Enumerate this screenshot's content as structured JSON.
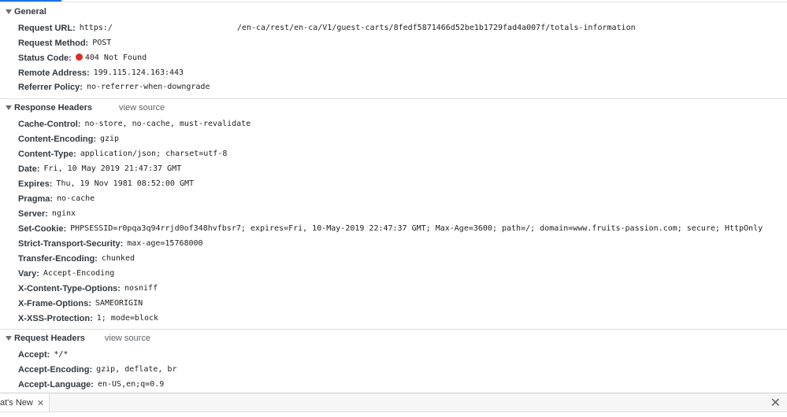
{
  "general": {
    "title": "General",
    "rows": [
      {
        "key": "Request URL:",
        "value_prefix": "https:/",
        "value_suffix": "/en-ca/rest/en-ca/V1/guest-carts/8fedf5871466d52be1b1729fad4a007f/totals-information"
      },
      {
        "key": "Request Method:",
        "value": "POST"
      },
      {
        "key": "Status Code:",
        "value": "404 Not Found",
        "status_color": "#d93025"
      },
      {
        "key": "Remote Address:",
        "value": "199.115.124.163:443"
      },
      {
        "key": "Referrer Policy:",
        "value": "no-referrer-when-downgrade"
      }
    ]
  },
  "response_headers": {
    "title": "Response Headers",
    "view_source": "view source",
    "rows": [
      {
        "key": "Cache-Control:",
        "value": "no-store, no-cache, must-revalidate"
      },
      {
        "key": "Content-Encoding:",
        "value": "gzip"
      },
      {
        "key": "Content-Type:",
        "value": "application/json; charset=utf-8"
      },
      {
        "key": "Date:",
        "value": "Fri, 10 May 2019 21:47:37 GMT"
      },
      {
        "key": "Expires:",
        "value": "Thu, 19 Nov 1981 08:52:00 GMT"
      },
      {
        "key": "Pragma:",
        "value": "no-cache"
      },
      {
        "key": "Server:",
        "value": "nginx"
      },
      {
        "key": "Set-Cookie:",
        "value": "PHPSESSID=r0pqa3q94rrjd0of348hvfbsr7; expires=Fri, 10-May-2019 22:47:37 GMT; Max-Age=3600; path=/; domain=www.fruits-passion.com; secure; HttpOnly"
      },
      {
        "key": "Strict-Transport-Security:",
        "value": "max-age=15768000"
      },
      {
        "key": "Transfer-Encoding:",
        "value": "chunked"
      },
      {
        "key": "Vary:",
        "value": "Accept-Encoding"
      },
      {
        "key": "X-Content-Type-Options:",
        "value": "nosniff"
      },
      {
        "key": "X-Frame-Options:",
        "value": "SAMEORIGIN"
      },
      {
        "key": "X-XSS-Protection:",
        "value": "1; mode=block"
      }
    ]
  },
  "request_headers": {
    "title": "Request Headers",
    "view_source": "view source",
    "rows": [
      {
        "key": "Accept:",
        "value": "*/*"
      },
      {
        "key": "Accept-Encoding:",
        "value": "gzip, deflate, br"
      },
      {
        "key": "Accept-Language:",
        "value": "en-US,en;q=0.9"
      }
    ]
  },
  "drawer": {
    "tab_label": "at's New",
    "tab_close": "✕",
    "close": "✕"
  }
}
